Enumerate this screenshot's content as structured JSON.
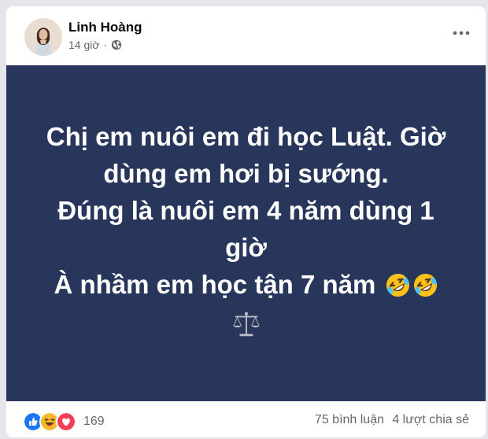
{
  "post": {
    "author": "Linh Hoàng",
    "time": "14 giờ",
    "privacy_icon": "globe-icon",
    "lines": [
      "Chị em nuôi em đi học Luật. Giờ",
      "dùng em hơi bị sướng.",
      "Đúng là nuôi em 4 năm dùng 1",
      "giờ",
      "À nhầm em học tận 7 năm"
    ],
    "background_color": "#28365b",
    "emojis": [
      "rolling-on-floor-laughing-icon",
      "rolling-on-floor-laughing-icon",
      "balance-scale-icon"
    ]
  },
  "footer": {
    "reaction_icons": [
      "like-icon",
      "haha-icon",
      "love-icon"
    ],
    "reaction_count": "169",
    "comments": "75 bình luận",
    "shares": "4 lượt chia sẻ"
  },
  "colors": {
    "like": "#1877f2",
    "haha": "#f7b928",
    "love": "#f33e58"
  }
}
